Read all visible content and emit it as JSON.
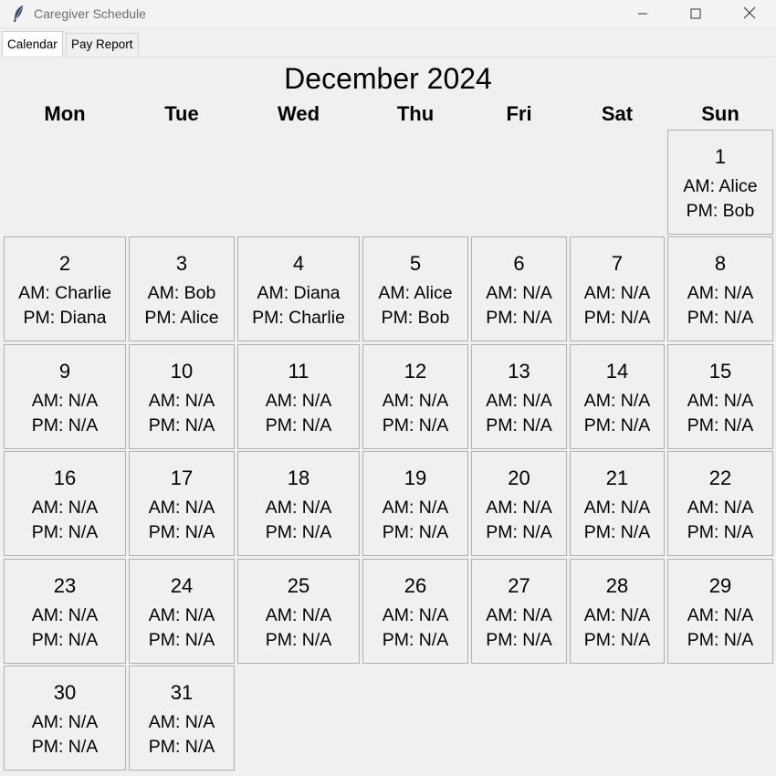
{
  "window": {
    "title": "Caregiver Schedule"
  },
  "tabs": [
    {
      "label": "Calendar",
      "active": true
    },
    {
      "label": "Pay Report",
      "active": false
    }
  ],
  "calendar": {
    "month_title": "December 2024",
    "weekdays": [
      "Mon",
      "Tue",
      "Wed",
      "Thu",
      "Fri",
      "Sat",
      "Sun"
    ],
    "days": [
      {
        "day": "1",
        "am": "AM: Alice",
        "pm": "PM: Bob"
      },
      {
        "day": "2",
        "am": "AM: Charlie",
        "pm": "PM: Diana"
      },
      {
        "day": "3",
        "am": "AM: Bob",
        "pm": "PM: Alice"
      },
      {
        "day": "4",
        "am": "AM: Diana",
        "pm": "PM: Charlie"
      },
      {
        "day": "5",
        "am": "AM: Alice",
        "pm": "PM: Bob"
      },
      {
        "day": "6",
        "am": "AM: N/A",
        "pm": "PM: N/A"
      },
      {
        "day": "7",
        "am": "AM: N/A",
        "pm": "PM: N/A"
      },
      {
        "day": "8",
        "am": "AM: N/A",
        "pm": "PM: N/A"
      },
      {
        "day": "9",
        "am": "AM: N/A",
        "pm": "PM: N/A"
      },
      {
        "day": "10",
        "am": "AM: N/A",
        "pm": "PM: N/A"
      },
      {
        "day": "11",
        "am": "AM: N/A",
        "pm": "PM: N/A"
      },
      {
        "day": "12",
        "am": "AM: N/A",
        "pm": "PM: N/A"
      },
      {
        "day": "13",
        "am": "AM: N/A",
        "pm": "PM: N/A"
      },
      {
        "day": "14",
        "am": "AM: N/A",
        "pm": "PM: N/A"
      },
      {
        "day": "15",
        "am": "AM: N/A",
        "pm": "PM: N/A"
      },
      {
        "day": "16",
        "am": "AM: N/A",
        "pm": "PM: N/A"
      },
      {
        "day": "17",
        "am": "AM: N/A",
        "pm": "PM: N/A"
      },
      {
        "day": "18",
        "am": "AM: N/A",
        "pm": "PM: N/A"
      },
      {
        "day": "19",
        "am": "AM: N/A",
        "pm": "PM: N/A"
      },
      {
        "day": "20",
        "am": "AM: N/A",
        "pm": "PM: N/A"
      },
      {
        "day": "21",
        "am": "AM: N/A",
        "pm": "PM: N/A"
      },
      {
        "day": "22",
        "am": "AM: N/A",
        "pm": "PM: N/A"
      },
      {
        "day": "23",
        "am": "AM: N/A",
        "pm": "PM: N/A"
      },
      {
        "day": "24",
        "am": "AM: N/A",
        "pm": "PM: N/A"
      },
      {
        "day": "25",
        "am": "AM: N/A",
        "pm": "PM: N/A"
      },
      {
        "day": "26",
        "am": "AM: N/A",
        "pm": "PM: N/A"
      },
      {
        "day": "27",
        "am": "AM: N/A",
        "pm": "PM: N/A"
      },
      {
        "day": "28",
        "am": "AM: N/A",
        "pm": "PM: N/A"
      },
      {
        "day": "29",
        "am": "AM: N/A",
        "pm": "PM: N/A"
      },
      {
        "day": "30",
        "am": "AM: N/A",
        "pm": "PM: N/A"
      },
      {
        "day": "31",
        "am": "AM: N/A",
        "pm": "PM: N/A"
      }
    ]
  },
  "icons": {
    "app": "feather-icon",
    "minimize": "minimize-icon",
    "maximize": "maximize-icon",
    "close": "close-icon"
  }
}
